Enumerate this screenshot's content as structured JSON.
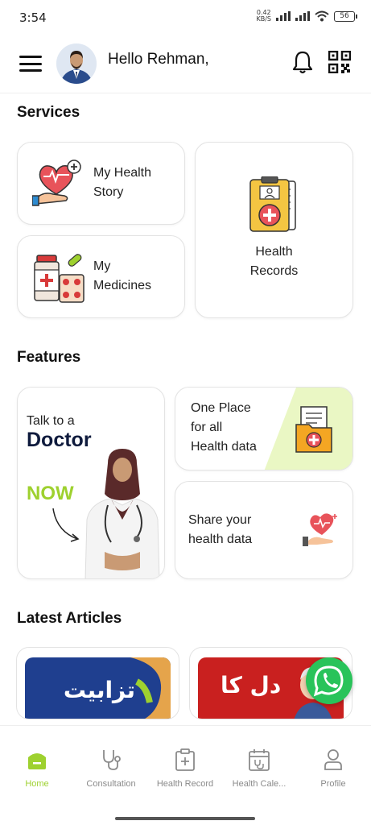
{
  "status_bar": {
    "time": "3:54",
    "speed_value": "0.42",
    "speed_unit": "KB/S",
    "battery": "56"
  },
  "header": {
    "greeting": "Hello Rehman,"
  },
  "services": {
    "title": "Services",
    "items": [
      {
        "label": "My Health\nStory",
        "icon": "health-story-icon"
      },
      {
        "label": "My\nMedicines",
        "icon": "medicines-icon"
      },
      {
        "label": "Health\nRecords",
        "icon": "health-records-icon"
      }
    ]
  },
  "features": {
    "title": "Features",
    "doctor_card": {
      "line1": "Talk to a",
      "line2": "Doctor",
      "line3": "NOW"
    },
    "one_place": "One Place\nfor all\nHealth data",
    "share": "Share your\nhealth data"
  },
  "articles": {
    "title": "Latest Articles",
    "items": [
      {
        "text": "تزابیت",
        "bg": "#1f3f8f"
      },
      {
        "text": "دل کا",
        "bg": "#c9201f"
      }
    ]
  },
  "nav": {
    "items": [
      {
        "label": "Home",
        "icon": "home-icon",
        "active": true
      },
      {
        "label": "Consultation",
        "icon": "stethoscope-icon",
        "active": false
      },
      {
        "label": "Health Record",
        "icon": "clipboard-icon",
        "active": false
      },
      {
        "label": "Health Cale...",
        "icon": "calendar-icon",
        "active": false
      },
      {
        "label": "Profile",
        "icon": "profile-icon",
        "active": false
      }
    ]
  },
  "colors": {
    "accent": "#9ed12f",
    "navy": "#0f1b3d",
    "whatsapp": "#29c35a"
  }
}
